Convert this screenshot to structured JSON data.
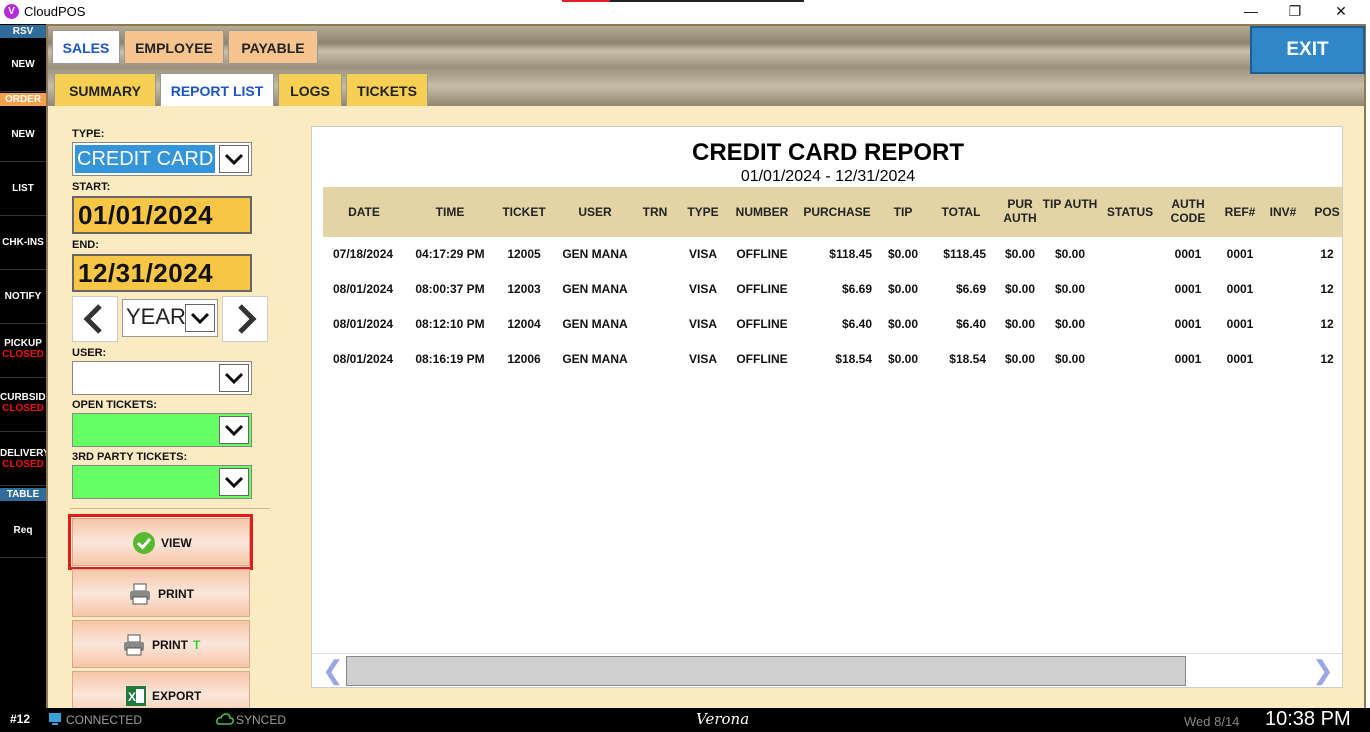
{
  "window": {
    "title": "CloudPOS",
    "logo_letter": "V",
    "minimize": "—",
    "restore": "❐",
    "close": "✕"
  },
  "rail": {
    "headers": {
      "rsv": "RSV",
      "order": "ORDER",
      "table": "TABLE"
    },
    "items": {
      "rsv_new": "NEW",
      "order_new": "NEW",
      "list": "LIST",
      "chkins": "CHK-INS",
      "notify": "NOTIFY",
      "pickup": "PICKUP",
      "pickup_status": "CLOSED",
      "curbside": "CURBSIDE",
      "curbside_status": "CLOSED",
      "delivery": "DELIVERY",
      "delivery_status": "CLOSED",
      "req": "Req"
    }
  },
  "top_tabs": [
    {
      "label": "SALES"
    },
    {
      "label": "EMPLOYEE"
    },
    {
      "label": "PAYABLE"
    }
  ],
  "exit_label": "EXIT",
  "sub_tabs": [
    {
      "label": "SUMMARY"
    },
    {
      "label": "REPORT LIST"
    },
    {
      "label": "LOGS"
    },
    {
      "label": "TICKETS"
    }
  ],
  "filters": {
    "type_label": "TYPE:",
    "type_value": "CREDIT CARD",
    "start_label": "START:",
    "start_value": "01/01/2024",
    "end_label": "END:",
    "end_value": "12/31/2024",
    "period_value": "YEAR",
    "user_label": "USER:",
    "user_value": "",
    "open_tickets_label": "OPEN TICKETS:",
    "third_party_label": "3RD PARTY TICKETS:"
  },
  "actions": {
    "view": "VIEW",
    "print": "PRINT",
    "print_t": "PRINT",
    "print_t_suffix": "T",
    "export": "EXPORT"
  },
  "report": {
    "title": "CREDIT CARD REPORT",
    "range": "01/01/2024 - 12/31/2024",
    "columns": [
      "DATE",
      "TIME",
      "TICKET",
      "USER",
      "TRN",
      "TYPE",
      "NUMBER",
      "PURCHASE",
      "TIP",
      "TOTAL",
      "PUR AUTH",
      "TIP AUTH",
      "STATUS",
      "AUTH CODE",
      "REF#",
      "INV#",
      "POS"
    ],
    "rows": [
      {
        "date": "07/18/2024",
        "time": "04:17:29 PM",
        "ticket": "12005",
        "user": "GEN MANA",
        "trn": "",
        "type": "VISA",
        "number": "OFFLINE",
        "purchase": "$118.45",
        "tip": "$0.00",
        "total": "$118.45",
        "pur_auth": "$0.00",
        "tip_auth": "$0.00",
        "status": "",
        "auth_code": "0001",
        "ref": "0001",
        "inv": "",
        "pos": "12"
      },
      {
        "date": "08/01/2024",
        "time": "08:00:37 PM",
        "ticket": "12003",
        "user": "GEN MANA",
        "trn": "",
        "type": "VISA",
        "number": "OFFLINE",
        "purchase": "$6.69",
        "tip": "$0.00",
        "total": "$6.69",
        "pur_auth": "$0.00",
        "tip_auth": "$0.00",
        "status": "",
        "auth_code": "0001",
        "ref": "0001",
        "inv": "",
        "pos": "12"
      },
      {
        "date": "08/01/2024",
        "time": "08:12:10 PM",
        "ticket": "12004",
        "user": "GEN MANA",
        "trn": "",
        "type": "VISA",
        "number": "OFFLINE",
        "purchase": "$6.40",
        "tip": "$0.00",
        "total": "$6.40",
        "pur_auth": "$0.00",
        "tip_auth": "$0.00",
        "status": "",
        "auth_code": "0001",
        "ref": "0001",
        "inv": "",
        "pos": "12"
      },
      {
        "date": "08/01/2024",
        "time": "08:16:19 PM",
        "ticket": "12006",
        "user": "GEN MANA",
        "trn": "",
        "type": "VISA",
        "number": "OFFLINE",
        "purchase": "$18.54",
        "tip": "$0.00",
        "total": "$18.54",
        "pur_auth": "$0.00",
        "tip_auth": "$0.00",
        "status": "",
        "auth_code": "0001",
        "ref": "0001",
        "inv": "",
        "pos": "12"
      }
    ]
  },
  "status": {
    "station": "#12",
    "connection": "CONNECTED",
    "sync": "SYNCED",
    "location": "Verona",
    "date": "Wed 8/14",
    "time": "10:38 PM"
  },
  "colors": {
    "accent_blue": "#1a56c9",
    "exit_blue": "#2f86c9",
    "panel_cream": "#fbebc2",
    "header_tan": "#e3d4a6",
    "date_yellow": "#f7c644",
    "green_field": "#66ff66",
    "closed_red": "#e11111",
    "highlight_red": "#e01c1c"
  }
}
